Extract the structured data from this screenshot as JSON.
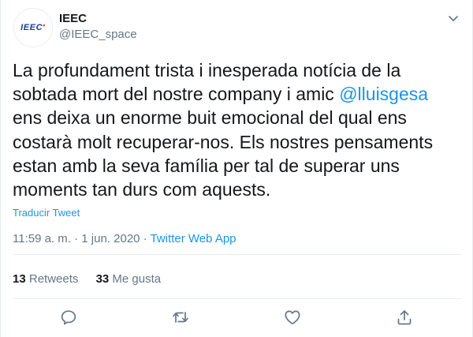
{
  "account": {
    "avatar_text": "IEEC",
    "name": "IEEC",
    "handle": "@IEEC_space"
  },
  "tweet": {
    "text_before": "La profundament trista i inesperada notícia de la\nsobtada mort del nostre company i amic ",
    "mention": "@lluisgesa",
    "text_after": "\nens deixa un enorme buit emocional del qual ens\ncostarà molt recuperar-nos. Els nostres pensaments\nestan amb la seva família per tal de superar uns\nmoments tan durs com aquests.",
    "translate_label": "Traducir Tweet",
    "time": "11:59 a. m.",
    "date": "1 jun. 2020",
    "separator": " · ",
    "source": "Twitter Web App"
  },
  "stats": {
    "retweets_count": "13",
    "retweets_label": "Retweets",
    "likes_count": "33",
    "likes_label": "Me gusta"
  },
  "icons": {
    "menu": "chevron-down-icon",
    "reply": "reply-icon",
    "retweet": "retweet-icon",
    "like": "heart-icon",
    "share": "share-icon"
  },
  "colors": {
    "link": "#1b95e0",
    "secondary_text": "#657786",
    "divider": "#e6ecf0",
    "icon": "#657786"
  }
}
